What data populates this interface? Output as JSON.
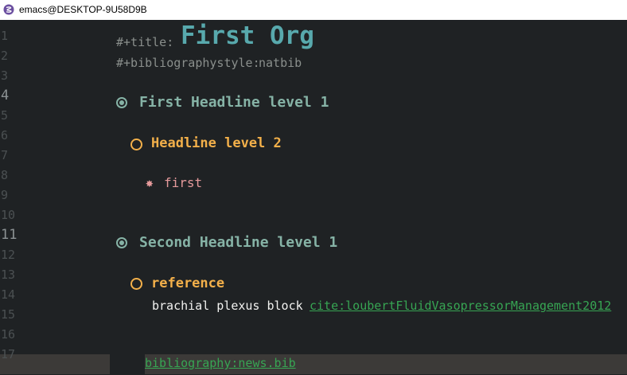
{
  "window": {
    "title": "emacs@DESKTOP-9U58D9B",
    "icon": "emacs-icon"
  },
  "editor": {
    "line_numbers": [
      "1",
      "2",
      "3",
      "4",
      "5",
      "6",
      "7",
      "8",
      "9",
      "10",
      "11",
      "12",
      "13",
      "14",
      "15",
      "16",
      "17"
    ],
    "keywords": {
      "title_keyword": "#+title:",
      "title_value": "First Org",
      "bib_keyword": "#+bibliographystyle:",
      "bib_value": "natbib"
    },
    "headline1": {
      "bullet": "radio-filled-icon",
      "text": "First Headline level 1"
    },
    "headline2": {
      "bullet": "circle-icon",
      "text": "Headline level 2"
    },
    "headline3": {
      "bullet": "✸",
      "text": "first"
    },
    "headline4": {
      "bullet": "radio-filled-icon",
      "text": "Second Headline level 1"
    },
    "headline5": {
      "bullet": "circle-icon",
      "text": "reference"
    },
    "body_text": "brachial plexus block",
    "cite_link": "cite:loubertFluidVasopressorManagement2012",
    "bib_link": "bibliography:news.bib"
  },
  "colors": {
    "background": "#1f2224",
    "headline_level1": "#86b3a6",
    "headline_level2": "#f3b04a",
    "headline_level3": "#e59a9b",
    "link": "#37a553",
    "doc_title": "#58a9ad"
  }
}
